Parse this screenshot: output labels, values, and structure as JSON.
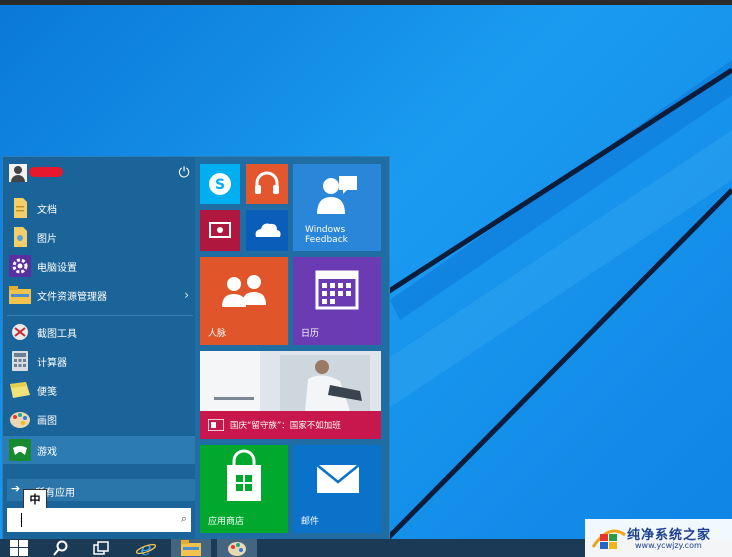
{
  "start_menu": {
    "user": {
      "name_redacted": true
    },
    "items": [
      {
        "label": "文档",
        "icon": "documents-icon"
      },
      {
        "label": "图片",
        "icon": "pictures-icon"
      },
      {
        "label": "电脑设置",
        "icon": "settings-gear-icon"
      },
      {
        "label": "文件资源管理器",
        "icon": "file-explorer-icon",
        "chevron": "›"
      },
      {
        "label": "截图工具",
        "icon": "snipping-tool-icon"
      },
      {
        "label": "计算器",
        "icon": "calculator-icon"
      },
      {
        "label": "便笺",
        "icon": "sticky-notes-icon"
      },
      {
        "label": "画图",
        "icon": "paint-icon"
      },
      {
        "label": "游戏",
        "icon": "games-icon"
      }
    ],
    "all_apps_label": "所有应用",
    "ime_indicator": "中",
    "search_placeholder": ""
  },
  "tiles": {
    "windows_feedback": "Windows\nFeedback",
    "people": "人脉",
    "calendar": "日历",
    "news": "国庆“留守族”：国家不如加班",
    "store": "应用商店",
    "mail": "邮件"
  },
  "watermark": {
    "title": "纯净系统之家",
    "url": "www.ycwjzy.com"
  },
  "colors": {
    "desktop": "#1a9bf0",
    "start_bg": "#1f6da3",
    "skype": "#00aff0",
    "music": "#e4572e",
    "video": "#b0173e",
    "onedrive": "#0a5db8",
    "feedback": "#2a86d8",
    "people": "#e1552b",
    "calendar": "#6a3bb3",
    "news_bar": "#c8174d",
    "store": "#00a82d",
    "mail": "#0a72c9"
  }
}
